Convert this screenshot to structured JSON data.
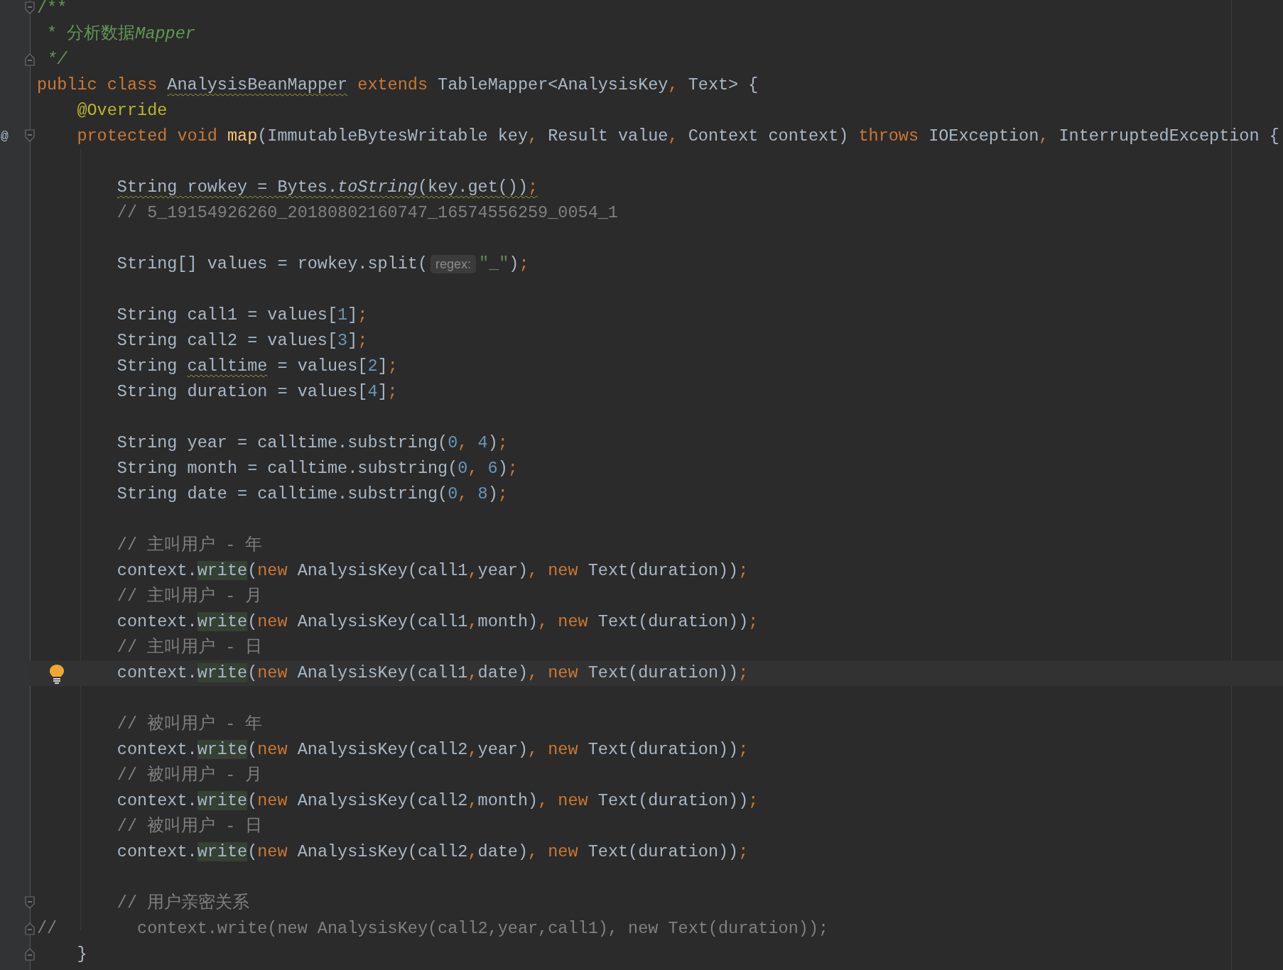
{
  "lines": [
    {
      "fold_start": true,
      "tokens": [
        {
          "text": "/**",
          "kind": "doc"
        }
      ]
    },
    {
      "tokens": [
        {
          "text": " * 分析数据",
          "kind": "doc"
        },
        {
          "text": "Mapper",
          "kind": "doc-italic"
        }
      ]
    },
    {
      "fold_end": true,
      "tokens": [
        {
          "text": " */",
          "kind": "doc-italic"
        }
      ]
    },
    {
      "tokens": [
        {
          "text": "public class ",
          "kind": "keyword"
        },
        {
          "text": "AnalysisBeanMapper",
          "kind": "plain",
          "warning": true
        },
        {
          "text": " extends",
          "kind": "keyword"
        },
        {
          "text": " TableMapper<AnalysisKey",
          "kind": "plain"
        },
        {
          "text": ",",
          "kind": "keyword"
        },
        {
          "text": " Text> {",
          "kind": "plain"
        }
      ]
    },
    {
      "tokens": [
        {
          "text": "    @Override",
          "kind": "annotation"
        }
      ]
    },
    {
      "mark": "@",
      "fold_start": true,
      "tokens": [
        {
          "text": "    protected void ",
          "kind": "keyword"
        },
        {
          "text": "map",
          "kind": "method"
        },
        {
          "text": "(ImmutableBytesWritable key",
          "kind": "plain"
        },
        {
          "text": ",",
          "kind": "keyword"
        },
        {
          "text": " Result value",
          "kind": "plain"
        },
        {
          "text": ",",
          "kind": "keyword"
        },
        {
          "text": " Context context) ",
          "kind": "plain"
        },
        {
          "text": "throws",
          "kind": "keyword"
        },
        {
          "text": " IOException",
          "kind": "plain"
        },
        {
          "text": ",",
          "kind": "keyword"
        },
        {
          "text": " InterruptedException {",
          "kind": "plain"
        }
      ]
    },
    {
      "blank_before": true,
      "tokens": [
        {
          "text": "        String rowkey = Bytes.",
          "kind": "plain",
          "warning": true
        },
        {
          "text": "toString",
          "kind": "static",
          "warning": true
        },
        {
          "text": "(key.get())",
          "kind": "plain",
          "warning": true
        },
        {
          "text": ";",
          "kind": "keyword",
          "warning": true
        }
      ]
    },
    {
      "tokens": [
        {
          "text": "        // 5_19154926260_20180802160747_16574556259_0054_1",
          "kind": "comment"
        }
      ]
    },
    {
      "blank_before": true,
      "tokens": [
        {
          "text": "        String[] values = rowkey.split(",
          "kind": "plain"
        },
        {
          "text": "regex:",
          "kind": "hint"
        },
        {
          "text": "\"_\"",
          "kind": "string"
        },
        {
          "text": ")",
          "kind": "plain"
        },
        {
          "text": ";",
          "kind": "keyword"
        }
      ]
    },
    {
      "blank_before": true,
      "tokens": [
        {
          "text": "        String call1 = values[",
          "kind": "plain"
        },
        {
          "text": "1",
          "kind": "number"
        },
        {
          "text": "]",
          "kind": "plain"
        },
        {
          "text": ";",
          "kind": "keyword"
        }
      ]
    },
    {
      "tokens": [
        {
          "text": "        String call2 = values[",
          "kind": "plain"
        },
        {
          "text": "3",
          "kind": "number"
        },
        {
          "text": "]",
          "kind": "plain"
        },
        {
          "text": ";",
          "kind": "keyword"
        }
      ]
    },
    {
      "tokens": [
        {
          "text": "        String ",
          "kind": "plain"
        },
        {
          "text": "calltime",
          "kind": "plain",
          "warning": true
        },
        {
          "text": " = values[",
          "kind": "plain"
        },
        {
          "text": "2",
          "kind": "number"
        },
        {
          "text": "]",
          "kind": "plain"
        },
        {
          "text": ";",
          "kind": "keyword"
        }
      ]
    },
    {
      "tokens": [
        {
          "text": "        String duration = values[",
          "kind": "plain"
        },
        {
          "text": "4",
          "kind": "number"
        },
        {
          "text": "]",
          "kind": "plain"
        },
        {
          "text": ";",
          "kind": "keyword"
        }
      ]
    },
    {
      "blank_before": true,
      "tokens": [
        {
          "text": "        String year = calltime.substring(",
          "kind": "plain"
        },
        {
          "text": "0",
          "kind": "number"
        },
        {
          "text": ",",
          "kind": "keyword"
        },
        {
          "text": " 4",
          "kind": "number"
        },
        {
          "text": ")",
          "kind": "plain"
        },
        {
          "text": ";",
          "kind": "keyword"
        }
      ]
    },
    {
      "tokens": [
        {
          "text": "        String month = calltime.substring(",
          "kind": "plain"
        },
        {
          "text": "0",
          "kind": "number"
        },
        {
          "text": ",",
          "kind": "keyword"
        },
        {
          "text": " 6",
          "kind": "number"
        },
        {
          "text": ")",
          "kind": "plain"
        },
        {
          "text": ";",
          "kind": "keyword"
        }
      ]
    },
    {
      "tokens": [
        {
          "text": "        String date = calltime.substring(",
          "kind": "plain"
        },
        {
          "text": "0",
          "kind": "number"
        },
        {
          "text": ",",
          "kind": "keyword"
        },
        {
          "text": " 8",
          "kind": "number"
        },
        {
          "text": ")",
          "kind": "plain"
        },
        {
          "text": ";",
          "kind": "keyword"
        }
      ]
    },
    {
      "blank_before": true,
      "tokens": [
        {
          "text": "        // 主叫用户 - 年",
          "kind": "comment"
        }
      ]
    },
    {
      "tokens": [
        {
          "text": "        context.",
          "kind": "plain"
        },
        {
          "text": "write",
          "kind": "usage"
        },
        {
          "text": "(",
          "kind": "plain"
        },
        {
          "text": "new",
          "kind": "keyword"
        },
        {
          "text": " AnalysisKey(call1",
          "kind": "plain"
        },
        {
          "text": ",",
          "kind": "keyword"
        },
        {
          "text": "year)",
          "kind": "plain"
        },
        {
          "text": ",",
          "kind": "keyword"
        },
        {
          "text": " new",
          "kind": "keyword"
        },
        {
          "text": " Text(duration))",
          "kind": "plain"
        },
        {
          "text": ";",
          "kind": "keyword"
        }
      ]
    },
    {
      "tokens": [
        {
          "text": "        // 主叫用户 - 月",
          "kind": "comment"
        }
      ]
    },
    {
      "tokens": [
        {
          "text": "        context.",
          "kind": "plain"
        },
        {
          "text": "write",
          "kind": "usage"
        },
        {
          "text": "(",
          "kind": "plain"
        },
        {
          "text": "new",
          "kind": "keyword"
        },
        {
          "text": " AnalysisKey(call1",
          "kind": "plain"
        },
        {
          "text": ",",
          "kind": "keyword"
        },
        {
          "text": "month)",
          "kind": "plain"
        },
        {
          "text": ",",
          "kind": "keyword"
        },
        {
          "text": " new",
          "kind": "keyword"
        },
        {
          "text": " Text(duration))",
          "kind": "plain"
        },
        {
          "text": ";",
          "kind": "keyword"
        }
      ]
    },
    {
      "tokens": [
        {
          "text": "        // 主叫用户 - 日",
          "kind": "comment"
        }
      ]
    },
    {
      "current": true,
      "bulb": true,
      "tokens": [
        {
          "text": "        context.",
          "kind": "plain"
        },
        {
          "text": "write",
          "kind": "usage"
        },
        {
          "text": "(",
          "kind": "plain"
        },
        {
          "text": "new",
          "kind": "keyword"
        },
        {
          "text": " AnalysisKey(call1",
          "kind": "plain"
        },
        {
          "text": ",",
          "kind": "keyword"
        },
        {
          "text": "date)",
          "kind": "plain"
        },
        {
          "text": ",",
          "kind": "keyword"
        },
        {
          "text": " new",
          "kind": "keyword"
        },
        {
          "text": " Text(duration))",
          "kind": "plain"
        },
        {
          "text": ";",
          "kind": "keyword"
        }
      ]
    },
    {
      "blank_before": true,
      "tokens": [
        {
          "text": "        // 被叫用户 - 年",
          "kind": "comment"
        }
      ]
    },
    {
      "tokens": [
        {
          "text": "        context.",
          "kind": "plain"
        },
        {
          "text": "write",
          "kind": "usage"
        },
        {
          "text": "(",
          "kind": "plain"
        },
        {
          "text": "new",
          "kind": "keyword"
        },
        {
          "text": " AnalysisKey(call2",
          "kind": "plain"
        },
        {
          "text": ",",
          "kind": "keyword"
        },
        {
          "text": "year)",
          "kind": "plain"
        },
        {
          "text": ",",
          "kind": "keyword"
        },
        {
          "text": " new",
          "kind": "keyword"
        },
        {
          "text": " Text(duration))",
          "kind": "plain"
        },
        {
          "text": ";",
          "kind": "keyword"
        }
      ]
    },
    {
      "tokens": [
        {
          "text": "        // 被叫用户 - 月",
          "kind": "comment"
        }
      ]
    },
    {
      "tokens": [
        {
          "text": "        context.",
          "kind": "plain"
        },
        {
          "text": "write",
          "kind": "usage"
        },
        {
          "text": "(",
          "kind": "plain"
        },
        {
          "text": "new",
          "kind": "keyword"
        },
        {
          "text": " AnalysisKey(call2",
          "kind": "plain"
        },
        {
          "text": ",",
          "kind": "keyword"
        },
        {
          "text": "month)",
          "kind": "plain"
        },
        {
          "text": ",",
          "kind": "keyword"
        },
        {
          "text": " new",
          "kind": "keyword"
        },
        {
          "text": " Text(duration))",
          "kind": "plain"
        },
        {
          "text": ";",
          "kind": "keyword"
        }
      ]
    },
    {
      "tokens": [
        {
          "text": "        // 被叫用户 - 日",
          "kind": "comment"
        }
      ]
    },
    {
      "tokens": [
        {
          "text": "        context.",
          "kind": "plain"
        },
        {
          "text": "write",
          "kind": "usage"
        },
        {
          "text": "(",
          "kind": "plain"
        },
        {
          "text": "new",
          "kind": "keyword"
        },
        {
          "text": " AnalysisKey(call2",
          "kind": "plain"
        },
        {
          "text": ",",
          "kind": "keyword"
        },
        {
          "text": "date)",
          "kind": "plain"
        },
        {
          "text": ",",
          "kind": "keyword"
        },
        {
          "text": " new",
          "kind": "keyword"
        },
        {
          "text": " Text(duration))",
          "kind": "plain"
        },
        {
          "text": ";",
          "kind": "keyword"
        }
      ]
    },
    {
      "blank_before": true,
      "fold_start": true,
      "tokens": [
        {
          "text": "        // 用户亲密关系",
          "kind": "comment"
        }
      ]
    },
    {
      "fold_end": true,
      "tokens": [
        {
          "text": "//        context.write(new AnalysisKey(call2,year,call1), new Text(duration));",
          "kind": "comment"
        }
      ]
    },
    {
      "fold_end": true,
      "tokens": [
        {
          "text": "    }",
          "kind": "plain"
        }
      ]
    }
  ]
}
